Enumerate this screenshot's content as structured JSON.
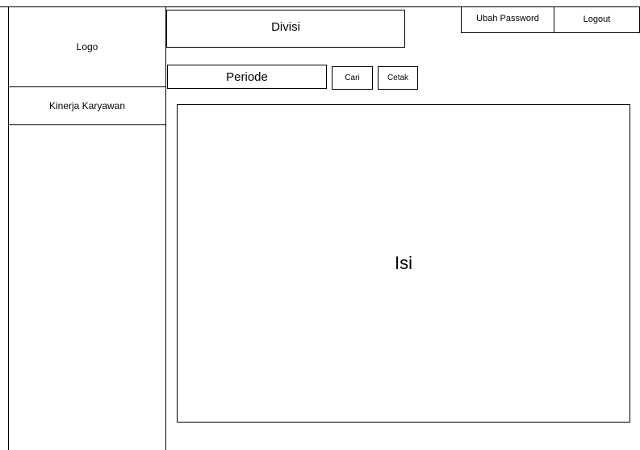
{
  "sidebar": {
    "logo_label": "Logo",
    "items": [
      {
        "label": "Kinerja Karyawan"
      }
    ]
  },
  "header": {
    "divisi_label": "Divisi",
    "ubah_password_label": "Ubah Password",
    "logout_label": "Logout"
  },
  "filter": {
    "periode_label": "Periode",
    "cari_label": "Cari",
    "cetak_label": "Cetak"
  },
  "main": {
    "content_label": "Isi"
  }
}
